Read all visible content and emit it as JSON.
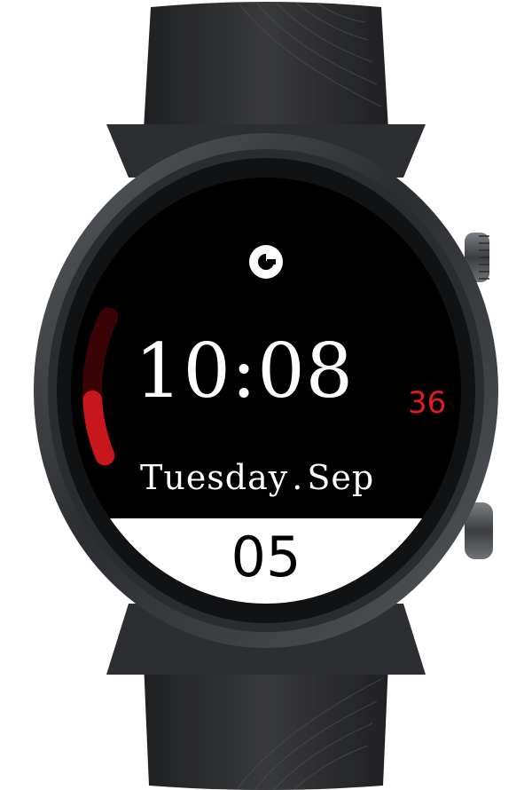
{
  "watch_face": {
    "time": {
      "hours": "10",
      "separator": ":",
      "minutes": "08",
      "seconds": "36"
    },
    "date": {
      "weekday": "Tuesday",
      "separator": ".",
      "month": "Sep",
      "day": "05"
    },
    "progress": {
      "value": 0.4,
      "fill_color": "#c8161d",
      "track_color": "#3a0306"
    },
    "colors": {
      "background": "#000000",
      "primary_text": "#ffffff",
      "seconds_accent": "#e11b22",
      "date_band": "#ffffff",
      "date_band_text": "#000000"
    },
    "logo_icon": "brand-logo-icon"
  },
  "device": {
    "case_color": "#2f3133",
    "strap_color": "#2a2b2d",
    "crown_buttons": [
      "top-crown-button",
      "bottom-crown-button"
    ]
  }
}
